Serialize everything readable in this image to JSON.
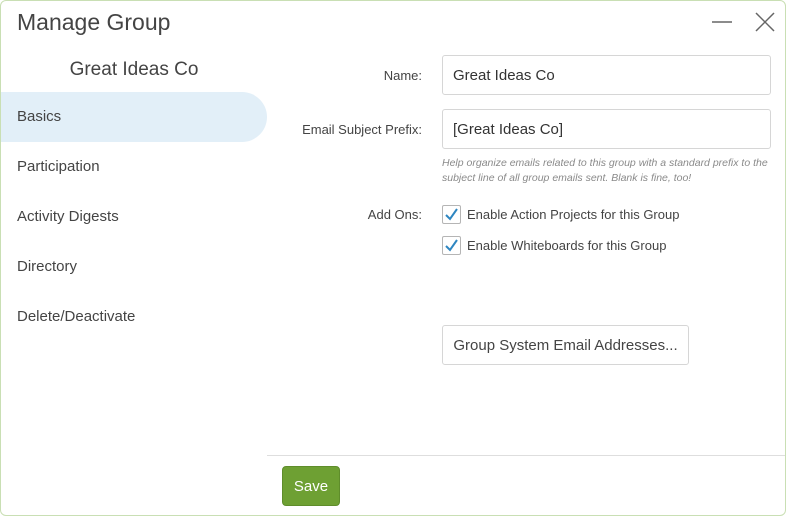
{
  "dialog": {
    "title": "Manage Group",
    "minimize_icon": "minimize-icon",
    "close_icon": "close-icon"
  },
  "sidebar": {
    "group_name": "Great Ideas Co",
    "items": [
      {
        "label": "Basics",
        "active": true
      },
      {
        "label": "Participation",
        "active": false
      },
      {
        "label": "Activity Digests",
        "active": false
      },
      {
        "label": "Directory",
        "active": false
      },
      {
        "label": "Delete/Deactivate",
        "active": false
      }
    ]
  },
  "form": {
    "name_label": "Name:",
    "name_value": "Great Ideas Co",
    "prefix_label": "Email Subject Prefix:",
    "prefix_value": "[Great Ideas Co]",
    "prefix_help": "Help organize emails related to this group with a standard prefix to the subject line of all group emails sent. Blank is fine, too!",
    "addons_label": "Add Ons:",
    "addons": [
      {
        "label": "Enable Action Projects for this Group",
        "checked": true
      },
      {
        "label": "Enable Whiteboards for this Group",
        "checked": true
      }
    ],
    "system_email_button": "Group System Email Addresses..."
  },
  "footer": {
    "save_label": "Save"
  },
  "colors": {
    "accent_green": "#6ea033",
    "active_nav_bg": "#e2eff8",
    "checkmark_blue": "#2e86c1"
  }
}
